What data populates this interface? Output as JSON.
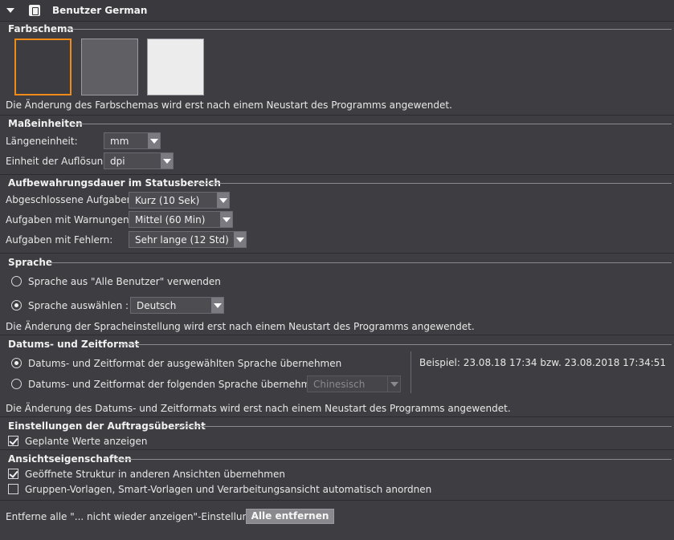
{
  "header": {
    "title": "Benutzer German"
  },
  "color_scheme": {
    "title": "Farbschema",
    "swatches": [
      {
        "color": "#3d3d41",
        "selected": true
      },
      {
        "color": "#5f5f64",
        "selected": false
      },
      {
        "color": "#ececec",
        "selected": false
      }
    ],
    "note": "Die Änderung des Farbschemas wird erst nach einem Neustart des Programms angewendet."
  },
  "units": {
    "title": "Maßeinheiten",
    "length_label": "Längeneinheit:",
    "length_value": "mm",
    "resolution_label": "Einheit der Auflösung:",
    "resolution_value": "dpi"
  },
  "retention": {
    "title": "Aufbewahrungsdauer im Statusbereich",
    "completed_label": "Abgeschlossene Aufgaben:",
    "completed_value": "Kurz (10 Sek)",
    "warnings_label": "Aufgaben mit Warnungen:",
    "warnings_value": "Mittel (60 Min)",
    "errors_label": "Aufgaben mit Fehlern:",
    "errors_value": "Sehr lange (12 Std)"
  },
  "language": {
    "title": "Sprache",
    "option_all_users": "Sprache aus \"Alle Benutzer\" verwenden",
    "option_select": "Sprache auswählen :",
    "selected_language": "Deutsch",
    "note": "Die Änderung der Spracheinstellung wird erst nach einem Neustart des Programms angewendet."
  },
  "datetime": {
    "title": "Datums- und Zeitformat",
    "option_selected_language": "Datums- und Zeitformat der ausgewählten Sprache übernehmen",
    "option_following_language": "Datums- und Zeitformat der folgenden Sprache übernehmen:",
    "following_language_value": "Chinesisch",
    "example": "Beispiel: 23.08.18 17:34 bzw. 23.08.2018 17:34:51",
    "note": "Die Änderung des Datums- und Zeitformats wird erst nach einem Neustart des Programms angewendet."
  },
  "job_overview": {
    "title": "Einstellungen der Auftragsübersicht",
    "show_planned": "Geplante Werte anzeigen"
  },
  "view_properties": {
    "title": "Ansichtseigenschaften",
    "apply_structure": "Geöffnete Struktur in anderen Ansichten übernehmen",
    "auto_arrange": "Gruppen-Vorlagen, Smart-Vorlagen und Verarbeitungsansicht automatisch anordnen"
  },
  "footer": {
    "label": "Entferne alle \"... nicht wieder anzeigen\"-Einstellungen:",
    "button": "Alle entfernen"
  }
}
